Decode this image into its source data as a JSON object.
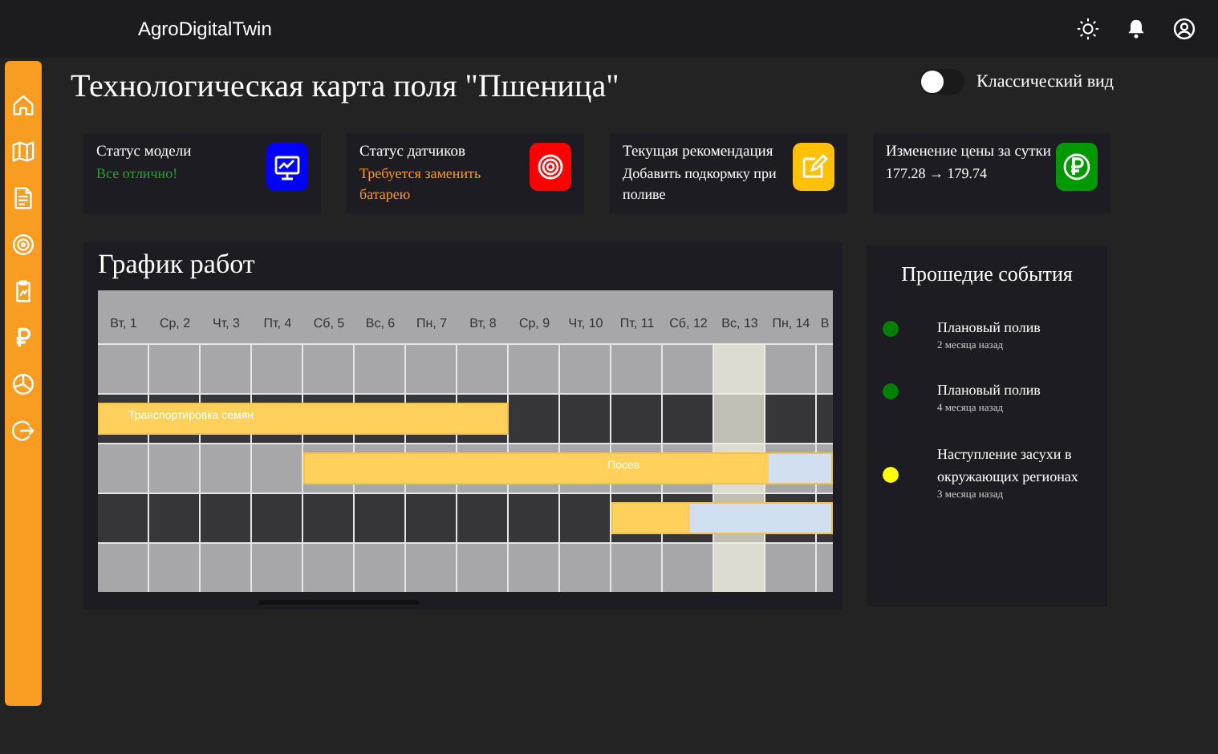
{
  "header": {
    "brand": "AgroDigitalTwin"
  },
  "page": {
    "title": "Технологическая карта поля \"Пшеница\"",
    "toggle": {
      "label": "Классический вид",
      "on": false
    }
  },
  "sidebar": {
    "items": [
      {
        "selected": false
      },
      {
        "selected": false
      },
      {
        "selected": false
      },
      {
        "selected": false
      },
      {
        "selected": false
      },
      {
        "selected": false
      },
      {
        "selected": false
      },
      {
        "selected": false
      }
    ]
  },
  "cards": [
    {
      "title": "Статус модели",
      "value": "Все отлично!",
      "ok": true,
      "warning": false,
      "color": "#0000ff"
    },
    {
      "title": "Статус датчиков",
      "value": "Требуется заменить батарею",
      "ok": false,
      "warning": true,
      "color": "#ff0000"
    },
    {
      "title": "Текущая рекомендация",
      "value": "Добавить подкормку при поливе",
      "ok": false,
      "warning": false,
      "color": "#ffc107"
    },
    {
      "title": "Изменение цены за сутки",
      "value": "177.28 → 179.74",
      "ok": false,
      "warning": false,
      "color": "#009900"
    }
  ],
  "schedule": {
    "title": "График работ",
    "days": [
      {
        "label": "Вт, 1",
        "today": false
      },
      {
        "label": "Ср, 2",
        "today": false
      },
      {
        "label": "Чт, 3",
        "today": false
      },
      {
        "label": "Пт, 4",
        "today": false
      },
      {
        "label": "Сб, 5",
        "today": false
      },
      {
        "label": "Вс, 6",
        "today": false
      },
      {
        "label": "Пн, 7",
        "today": false
      },
      {
        "label": "Вт, 8",
        "today": false
      },
      {
        "label": "Ср, 9",
        "today": false
      },
      {
        "label": "Чт, 10",
        "today": false
      },
      {
        "label": "Пт, 11",
        "today": false
      },
      {
        "label": "Сб, 12",
        "today": false
      },
      {
        "label": "Вс, 13",
        "today": true
      },
      {
        "label": "Пн, 14",
        "today": false
      },
      {
        "label": "В",
        "today": false
      }
    ],
    "rows": [
      {
        "kind": "light"
      },
      {
        "kind": "dark",
        "bar": {
          "label": "Транспортировка семян",
          "level": 1
        }
      },
      {
        "kind": "light",
        "bar": {
          "label": "Посев",
          "level": 0.88
        }
      },
      {
        "kind": "dark",
        "bar": {
          "level": 0.35
        }
      },
      {
        "kind": "light"
      }
    ]
  },
  "events": {
    "title": "Прошедие события",
    "items": [
      {
        "title": "Плановый полив",
        "time": "2 месяца назад",
        "color": "#008000"
      },
      {
        "title": "Плановый полив",
        "time": "4 месяца назад",
        "color": "#008000"
      },
      {
        "title": "Наступление засухи в окружающих регионах",
        "time": "3 месяца назад",
        "color": "#ffff00"
      }
    ]
  }
}
